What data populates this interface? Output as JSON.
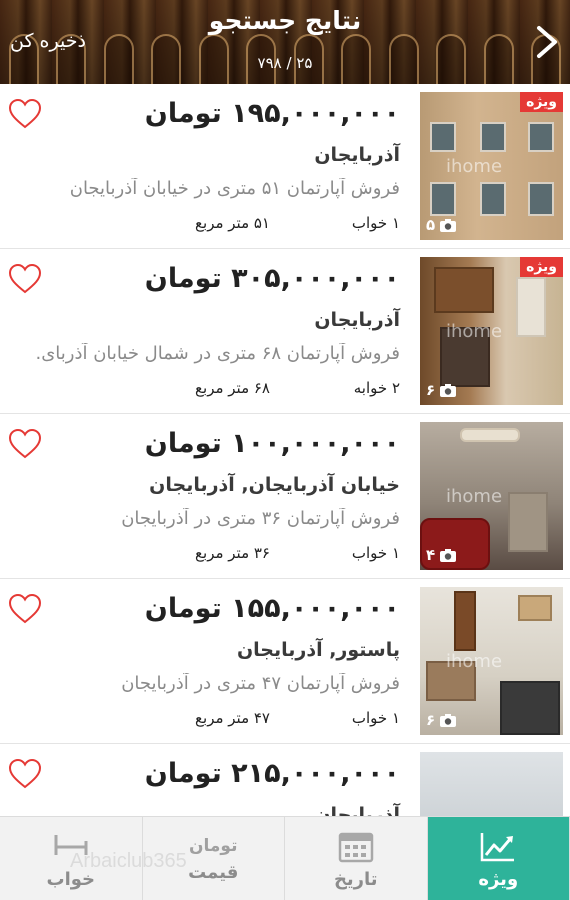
{
  "header": {
    "title": "نتایج جستجو",
    "count": "۲۵ / ۷۹۸",
    "save_label": "ذخیره کن"
  },
  "listings": [
    {
      "price": "۱۹۵,۰۰۰,۰۰۰ تومان",
      "location": "آذربایجان",
      "title": "فروش آپارتمان ۵۱ متری در خیابان آذربایجان",
      "rooms": "۱ خواب",
      "area": "۵۱ متر مربع",
      "photo_count": "۵",
      "badge": "ویژه",
      "watermark": "ihome"
    },
    {
      "price": "۳۰۵,۰۰۰,۰۰۰ تومان",
      "location": "آذربایجان",
      "title": "فروش آپارتمان ۶۸ متری در شمال خیابان آذربای.",
      "rooms": "۲ خوابه",
      "area": "۶۸ متر مربع",
      "photo_count": "۶",
      "badge": "ویژه",
      "watermark": "ihome"
    },
    {
      "price": "۱۰۰,۰۰۰,۰۰۰ تومان",
      "location": "خیابان آذربایجان, آذربایجان",
      "title": "فروش آپارتمان ۳۶ متری در آذربایجان",
      "rooms": "۱ خواب",
      "area": "۳۶ متر مربع",
      "photo_count": "۴",
      "badge": "",
      "watermark": "ihome"
    },
    {
      "price": "۱۵۵,۰۰۰,۰۰۰ تومان",
      "location": "پاستور, آذربایجان",
      "title": "فروش آپارتمان ۴۷ متری در آذربایجان",
      "rooms": "۱ خواب",
      "area": "۴۷ متر مربع",
      "photo_count": "۶",
      "badge": "",
      "watermark": "ihome"
    },
    {
      "price": "۲۱۵,۰۰۰,۰۰۰ تومان",
      "location": "آذربایجان",
      "title": "",
      "rooms": "",
      "area": "",
      "photo_count": "",
      "badge": "",
      "watermark": ""
    }
  ],
  "tabs": {
    "featured": {
      "label": "ویژه",
      "icon": "trending-chart-icon",
      "active": true
    },
    "date": {
      "label": "تاریخ",
      "icon": "calendar-icon"
    },
    "price": {
      "top": "تومان",
      "label": "قیمت"
    },
    "bedroom": {
      "label": "خواب",
      "icon": "bed-icon"
    }
  },
  "watermark_text": "Arbaiclub365",
  "colors": {
    "accent": "#2eb39a",
    "badge": "#e53935",
    "heart": "#e53935"
  }
}
